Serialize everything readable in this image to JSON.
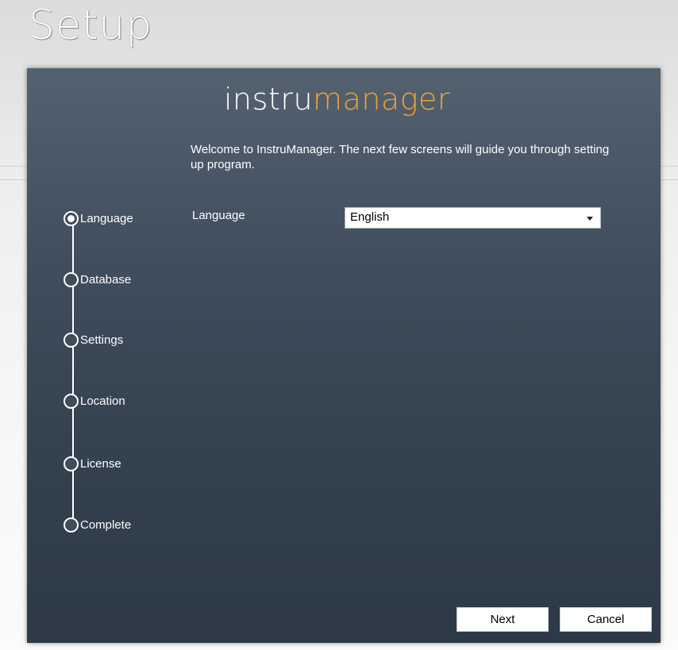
{
  "window": {
    "title": "Setup"
  },
  "logo": {
    "part1": "instru",
    "part2": "manager",
    "accent_color": "#f0a230"
  },
  "welcome_text": "Welcome to InstruManager. The next few screens will guide you through setting up program.",
  "steps": [
    {
      "label": "Language",
      "active": true
    },
    {
      "label": "Database",
      "active": false
    },
    {
      "label": "Settings",
      "active": false
    },
    {
      "label": "Location",
      "active": false
    },
    {
      "label": "License",
      "active": false
    },
    {
      "label": "Complete",
      "active": false
    }
  ],
  "form": {
    "language_label": "Language",
    "language_value": "English"
  },
  "buttons": {
    "next_label": "Next",
    "cancel_label": "Cancel"
  },
  "colors": {
    "dialog_top": "#536170",
    "dialog_bottom": "#2d3946"
  }
}
